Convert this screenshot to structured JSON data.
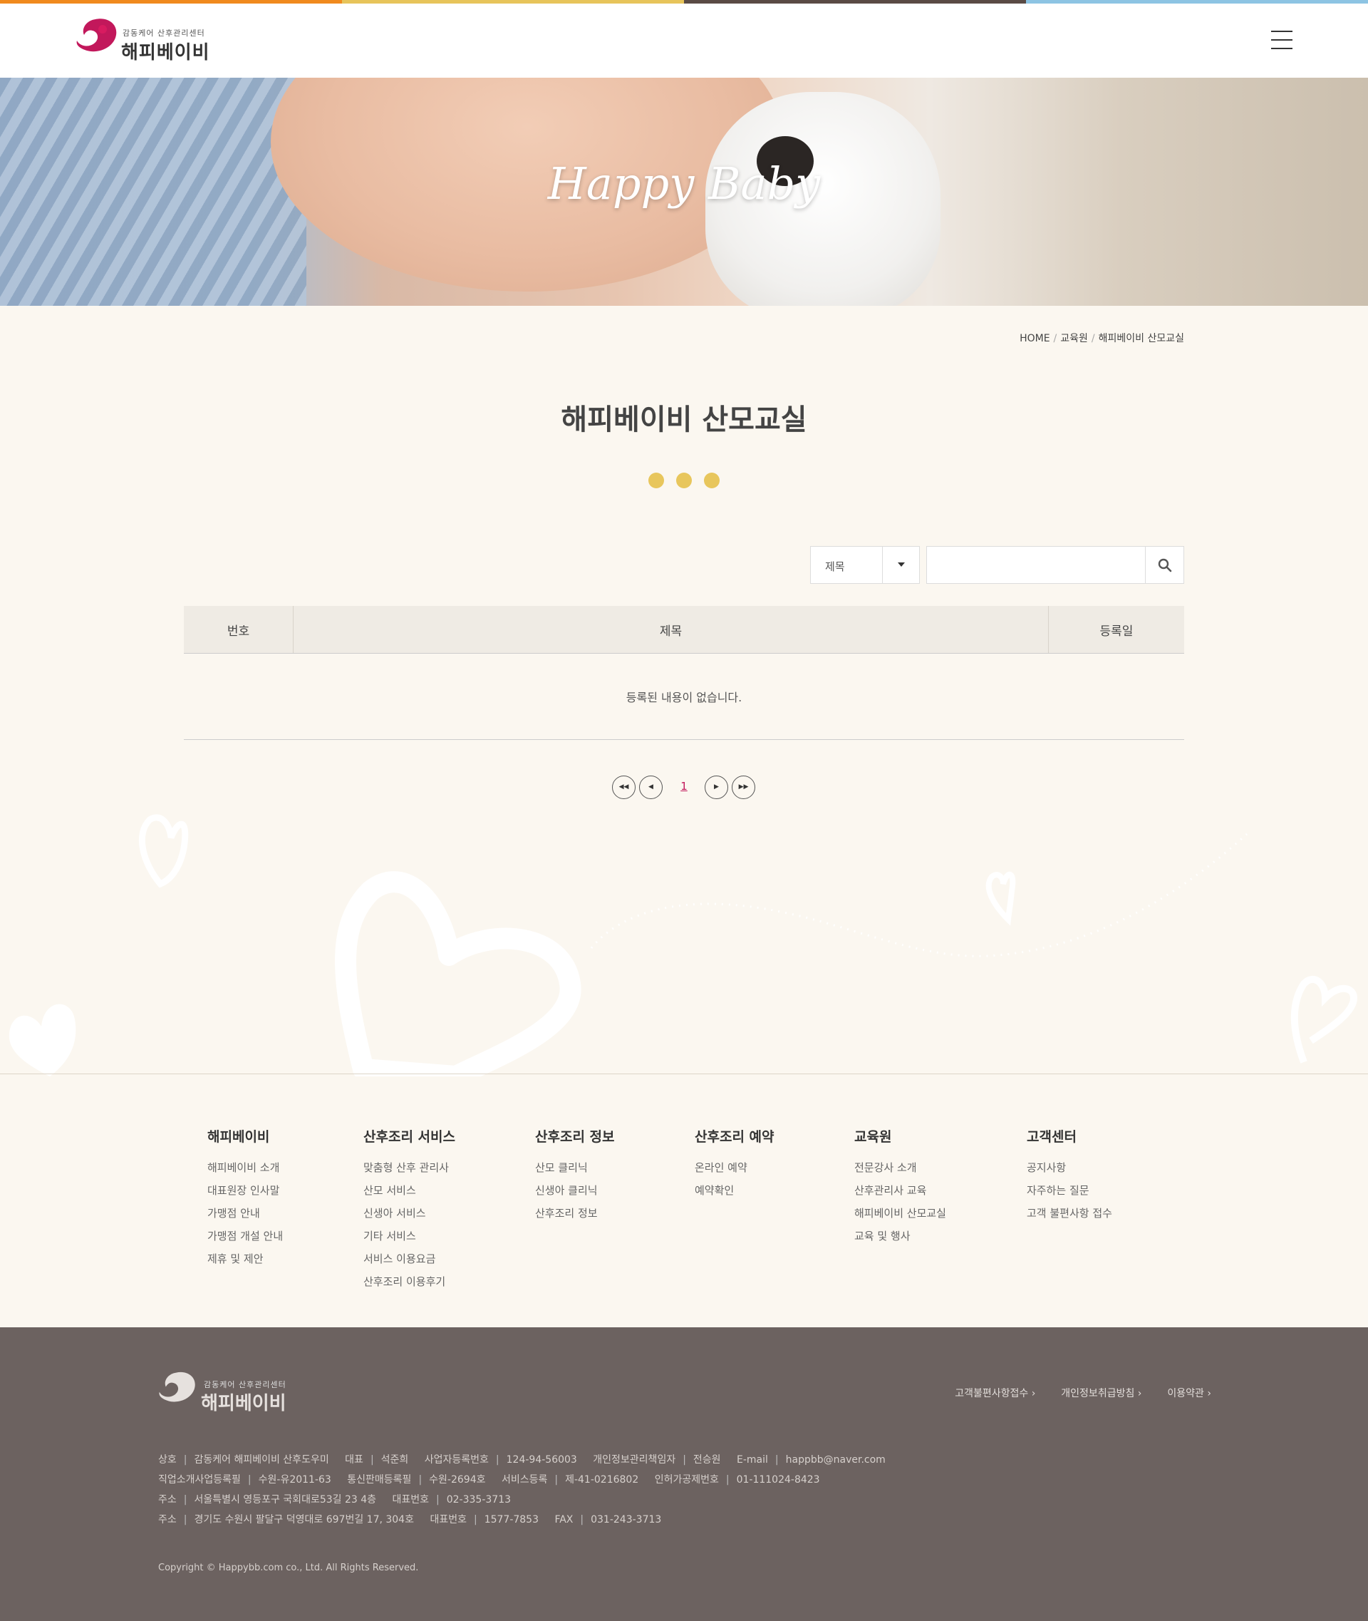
{
  "colors": {
    "strip": [
      "#f08a1e",
      "#e7c45a",
      "#5a4b45",
      "#8dc4e3"
    ],
    "brand_magenta": "#c2185b",
    "accent_yellow": "#e8c65c",
    "page_bg": "#fbf7f0",
    "footer_bg": "#6c6260"
  },
  "header": {
    "logo_sub": "감동케어  산후관리센터",
    "logo_main": "해피베이비",
    "menu_icon": "hamburger-icon"
  },
  "hero": {
    "title": "Happy Baby"
  },
  "breadcrumb": [
    "HOME",
    "교육원",
    "해피베이비 산모교실"
  ],
  "page": {
    "title": "해피베이비 산모교실"
  },
  "search": {
    "select_value": "제목",
    "input_value": "",
    "button_icon": "search-icon"
  },
  "table": {
    "headers": {
      "no": "번호",
      "title": "제목",
      "date": "등록일"
    },
    "empty_message": "등록된 내용이 없습니다."
  },
  "pagination": {
    "first": "◀◀",
    "prev": "◀",
    "current": "1",
    "next": "▶",
    "last": "▶▶"
  },
  "footer_nav": [
    {
      "title": "해피베이비",
      "items": [
        "해피베이비 소개",
        "대표원장 인사말",
        "가맹점 안내",
        "가맹점 개설 안내",
        "제휴 및 제안"
      ]
    },
    {
      "title": "산후조리 서비스",
      "items": [
        "맞춤형 산후 관리사",
        "산모 서비스",
        "신생아 서비스",
        "기타 서비스",
        "서비스 이용요금",
        "산후조리 이용후기"
      ]
    },
    {
      "title": "산후조리 정보",
      "items": [
        "산모 클리닉",
        "신생아 클리닉",
        "산후조리 정보"
      ]
    },
    {
      "title": "산후조리 예약",
      "items": [
        "온라인 예약",
        "예약확인"
      ]
    },
    {
      "title": "교육원",
      "items": [
        "전문강사 소개",
        "산후관리사 교육",
        "해피베이비 산모교실",
        "교육 및 행사"
      ]
    },
    {
      "title": "고객센터",
      "items": [
        "공지사항",
        "자주하는 질문",
        "고객 불편사항 접수"
      ]
    }
  ],
  "footer": {
    "logo_sub": "감동케어  산후관리센터",
    "logo_main": "해피베이비",
    "links": [
      "고객불편사항접수",
      "개인정보취급방침",
      "이용약관"
    ],
    "info": {
      "row1": [
        {
          "k": "상호",
          "v": "감동케어 해피베이비 산후도우미"
        },
        {
          "k": "대표",
          "v": "석준희"
        },
        {
          "k": "사업자등록번호",
          "v": "124-94-56003"
        },
        {
          "k": "개인정보관리책임자",
          "v": "전승원"
        },
        {
          "k": "E-mail",
          "v": "happbb@naver.com"
        }
      ],
      "row2": [
        {
          "k": "직업소개사업등록필",
          "v": "수원-유2011-63"
        },
        {
          "k": "통신판매등록필",
          "v": "수원-2694호"
        },
        {
          "k": "서비스등록",
          "v": "제-41-0216802"
        },
        {
          "k": "인허가공제번호",
          "v": "01-111024-8423"
        }
      ],
      "row3": [
        {
          "k": "주소",
          "v": "서울특별시 영등포구 국회대로53길 23 4층"
        },
        {
          "k": "대표번호",
          "v": "02-335-3713"
        }
      ],
      "row4": [
        {
          "k": "주소",
          "v": "경기도 수원시 팔달구 덕영대로 697번길 17, 304호"
        },
        {
          "k": "대표번호",
          "v": "1577-7853"
        },
        {
          "k": "FAX",
          "v": "031-243-3713"
        }
      ]
    },
    "copyright": "Copyright © Happybb.com co., Ltd. All Rights Reserved."
  }
}
